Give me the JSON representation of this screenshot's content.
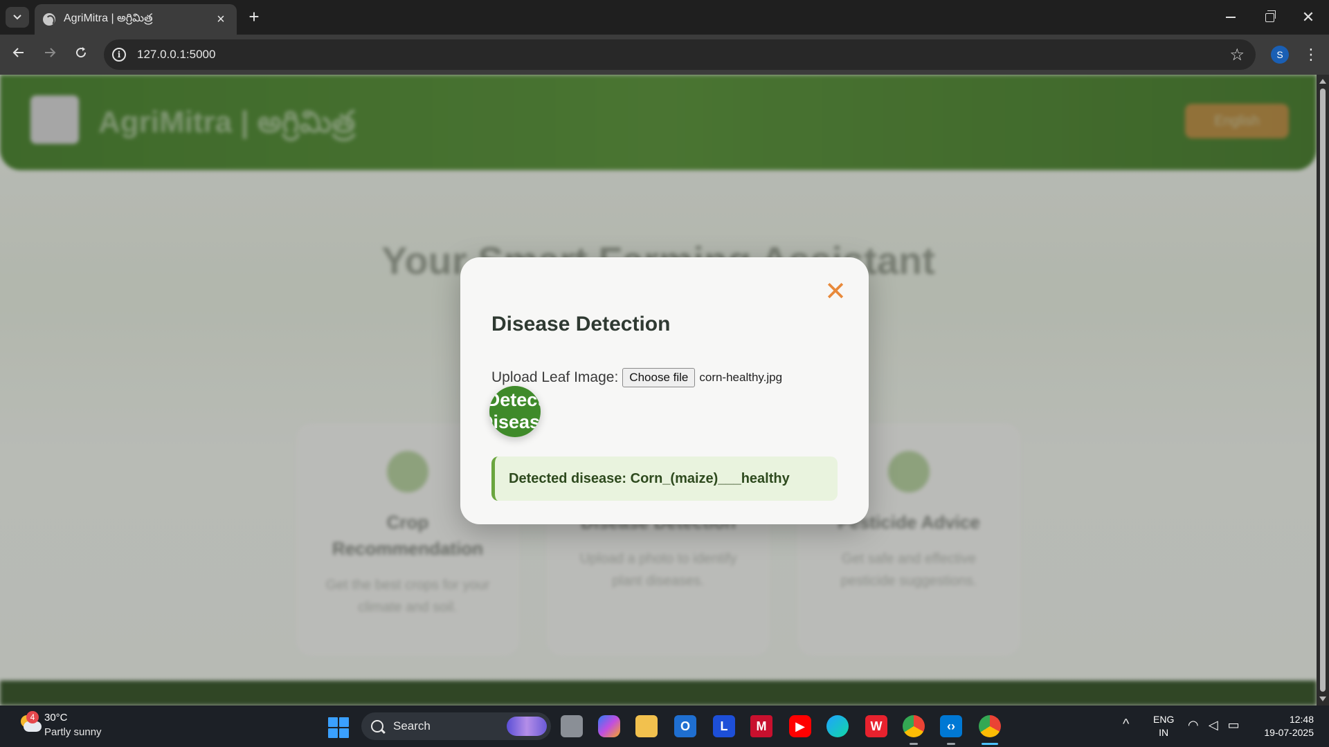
{
  "browser": {
    "tab_title": "AgriMitra | అగ్రిమిత్ర",
    "url": "127.0.0.1:5000"
  },
  "page": {
    "site_title": "AgriMitra | అగ్రిమిత్ర",
    "hero_heading": "Your Smart Farming Assistant",
    "cards": [
      {
        "title": "Crop Recommendation",
        "desc": "Get the best crops for your climate and soil."
      },
      {
        "title": "Disease Detection",
        "desc": "Upload a photo to identify plant diseases."
      },
      {
        "title": "Pesticide Advice",
        "desc": "Get safe and effective pesticide suggestions."
      }
    ]
  },
  "modal": {
    "close_glyph": "✕",
    "title": "Disease Detection",
    "upload_label": "Upload Leaf Image:",
    "choose_file_label": "Choose file",
    "file_name": "corn-healthy.jpg",
    "detect_button_label": "Detect Disease",
    "detect_line1": "Detect",
    "detect_line2": "Disease",
    "result_text": "Detected disease: Corn_(maize)___healthy"
  },
  "taskbar": {
    "weather_badge": "4",
    "weather_temp": "30°C",
    "weather_desc": "Partly sunny",
    "search_label": "Search",
    "lang_line1": "ENG",
    "lang_line2": "IN",
    "time": "12:48",
    "date": "19-07-2025",
    "profile_initial": "S"
  },
  "colors": {
    "header_green": "#4f8a2e",
    "accent_orange": "#e8893a",
    "detect_green": "#3f8a2a",
    "result_bg": "#e9f3de",
    "result_border": "#6aa53e"
  }
}
